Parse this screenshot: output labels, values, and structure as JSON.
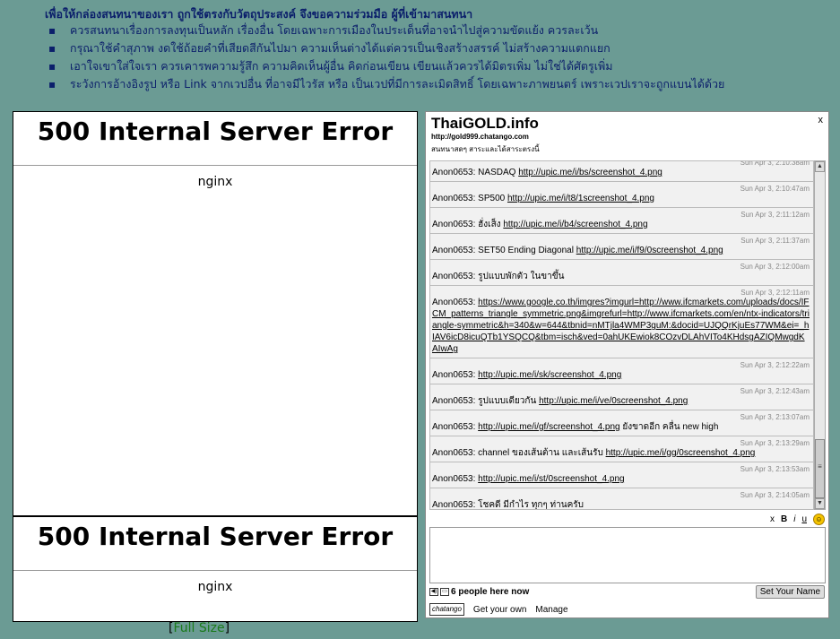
{
  "rules": {
    "heading": "เพื่อให้กล่องสนทนาของเรา ถูกใช้ตรงกับวัตถุประสงค์ จึงขอความร่วมมือ ผู้ที่เข้ามาสนทนา",
    "items": [
      "ควรสนทนาเรื่องการลงทุนเป็นหลัก เรื่องอื่น โดยเฉพาะการเมืองในประเด็นที่อาจนำไปสู่ความขัดแย้ง ควรละเว้น",
      "กรุณาใช้คำสุภาพ งดใช้ถ้อยคำที่เสียดสีกันไปมา ความเห็นต่างได้แต่ควรเป็นเชิงสร้างสรรค์ ไม่สร้างความแตกแยก",
      "เอาใจเขาใส่ใจเรา ควรเคารพความรู้สึก ความคิดเห็นผู้อื่น คิดก่อนเขียน เขียนแล้วควรได้มิตรเพิ่ม ไม่ใช่ได้ศัตรูเพิ่ม",
      "ระวังการอ้างอิงรูป หรือ Link จากเวปอื่น ที่อาจมีไวรัส หรือ เป็นเวปที่มีการละเมิดสิทธิ์ โดยเฉพาะภาพยนตร์ เพราะเวปเราจะถูกแบนได้ด้วย"
    ]
  },
  "error_top": {
    "title": "500 Internal Server Error",
    "body": "nginx"
  },
  "error_bottom": {
    "title": "500 Internal Server Error",
    "body": "nginx"
  },
  "fullsize": {
    "open": "[",
    "link": "Full Size",
    "close": "]"
  },
  "chat": {
    "title": "ThaiGOLD.info",
    "close": "x",
    "url": "http://gold999.chatango.com",
    "description": "สนทนาสดๆ สาระและได้สาระตรงนี้",
    "messages": [
      {
        "time": "Sun Apr 3, 2:10:38am",
        "user": "Anon0653:",
        "text": "NASDAQ",
        "link": "http://upic.me/i/bs/screenshot_4.png",
        "after": ""
      },
      {
        "time": "Sun Apr 3, 2:10:47am",
        "user": "Anon0653:",
        "text": "SP500",
        "link": "http://upic.me/i/t8/1screenshot_4.png",
        "after": ""
      },
      {
        "time": "Sun Apr 3, 2:11:12am",
        "user": "Anon0653:",
        "text": "ฮั่งเส็ง",
        "link": "http://upic.me/i/b4/screenshot_4.png",
        "after": ""
      },
      {
        "time": "Sun Apr 3, 2:11:37am",
        "user": "Anon0653:",
        "text": "SET50 Ending Diagonal",
        "link": "http://upic.me/i/f9/0screenshot_4.png",
        "after": ""
      },
      {
        "time": "Sun Apr 3, 2:12:00am",
        "user": "Anon0653:",
        "text": "รูปแบบพักตัว ในขาขึ้น",
        "link": "",
        "after": ""
      },
      {
        "time": "Sun Apr 3, 2:12:11am",
        "user": "Anon0653:",
        "text": "",
        "link": "https://www.google.co.th/imgres?imgurl=http://www.ifcmarkets.com/uploads/docs/IFCM_patterns_triangle_symmetric.png&imgrefurl=http://www.ifcmarkets.com/en/ntx-indicators/triangle-symmetric&h=340&w=644&tbnid=nMTjla4WMP3guM:&docid=UJQQrKjuEs77WM&ei=_hIAV6icD8icuQTb1YSQCQ&tbm=isch&ved=0ahUKEwiok8COzvDLAhVITo4KHdsgAZIQMwgdKAIwAg",
        "after": ""
      },
      {
        "time": "Sun Apr 3, 2:12:22am",
        "user": "Anon0653:",
        "text": "",
        "link": "http://upic.me/i/sk/screenshot_4.png",
        "after": ""
      },
      {
        "time": "Sun Apr 3, 2:12:43am",
        "user": "Anon0653:",
        "text": "รูปแบบเดียวกัน",
        "link": "http://upic.me/i/ve/0screenshot_4.png",
        "after": ""
      },
      {
        "time": "Sun Apr 3, 2:13:07am",
        "user": "Anon0653:",
        "text": "",
        "link": "http://upic.me/i/gf/screenshot_4.png",
        "after": "ยังขาดอีก คลื่น new high"
      },
      {
        "time": "Sun Apr 3, 2:13:29am",
        "user": "Anon0653:",
        "text": "channel ของเส้นต้าน และเส้นรับ",
        "link": "http://upic.me/i/gg/0screenshot_4.png",
        "after": ""
      },
      {
        "time": "Sun Apr 3, 2:13:53am",
        "user": "Anon0653:",
        "text": "",
        "link": "http://upic.me/i/st/0screenshot_4.png",
        "after": ""
      },
      {
        "time": "Sun Apr 3, 2:14:05am",
        "user": "Anon0653:",
        "text": "โชคดี มีกำไร ทุกๆ ท่านครับ",
        "link": "",
        "after": ""
      }
    ],
    "format": {
      "clear": "x",
      "bold": "B",
      "italic": "i",
      "underline": "u",
      "smiley": "☺"
    },
    "people": "6 people here now",
    "set_name": "Set Your Name",
    "footer": {
      "logo": "chatango",
      "get_own": "Get your own",
      "manage": "Manage"
    }
  }
}
